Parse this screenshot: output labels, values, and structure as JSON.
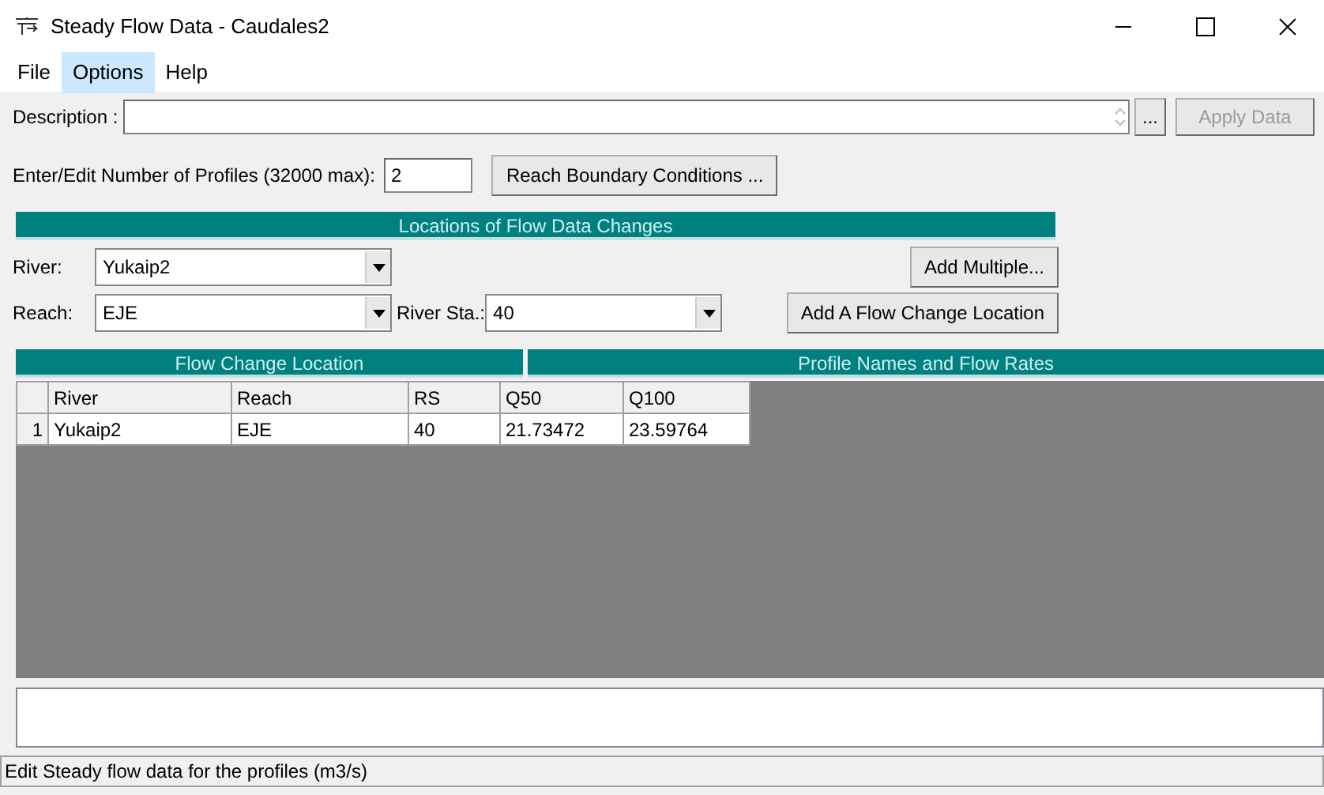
{
  "window": {
    "title": "Steady Flow Data - Caudales2"
  },
  "menu": [
    {
      "label": "File",
      "selected": false
    },
    {
      "label": "Options",
      "selected": true
    },
    {
      "label": "Help",
      "selected": false
    }
  ],
  "description": {
    "label": "Description :"
  },
  "browse_button": "...",
  "apply_button": {
    "label": "Apply Data",
    "disabled": true
  },
  "profiles": {
    "label": "Enter/Edit Number of Profiles (32000 max):",
    "value": "2"
  },
  "boundary_button": "Reach Boundary Conditions ...",
  "locations": {
    "title": "Locations of Flow Data Changes",
    "river": {
      "label": "River:",
      "value": "Yukaip2"
    },
    "reach": {
      "label": "Reach:",
      "value": "EJE"
    },
    "river_sta": {
      "label": "River Sta.:",
      "value": "40"
    },
    "add_multiple": "Add Multiple...",
    "add_location": "Add A Flow Change Location"
  },
  "table": {
    "group_headers": [
      "Flow Change Location",
      "Profile Names and Flow Rates"
    ],
    "columns": [
      "River",
      "Reach",
      "RS",
      "Q50",
      "Q100"
    ],
    "rows": [
      {
        "number": "1",
        "cells": [
          "Yukaip2",
          "EJE",
          "40",
          "21.73472",
          "23.59764"
        ]
      }
    ]
  },
  "status_bar": "Edit Steady flow data for the profiles (m3/s)"
}
